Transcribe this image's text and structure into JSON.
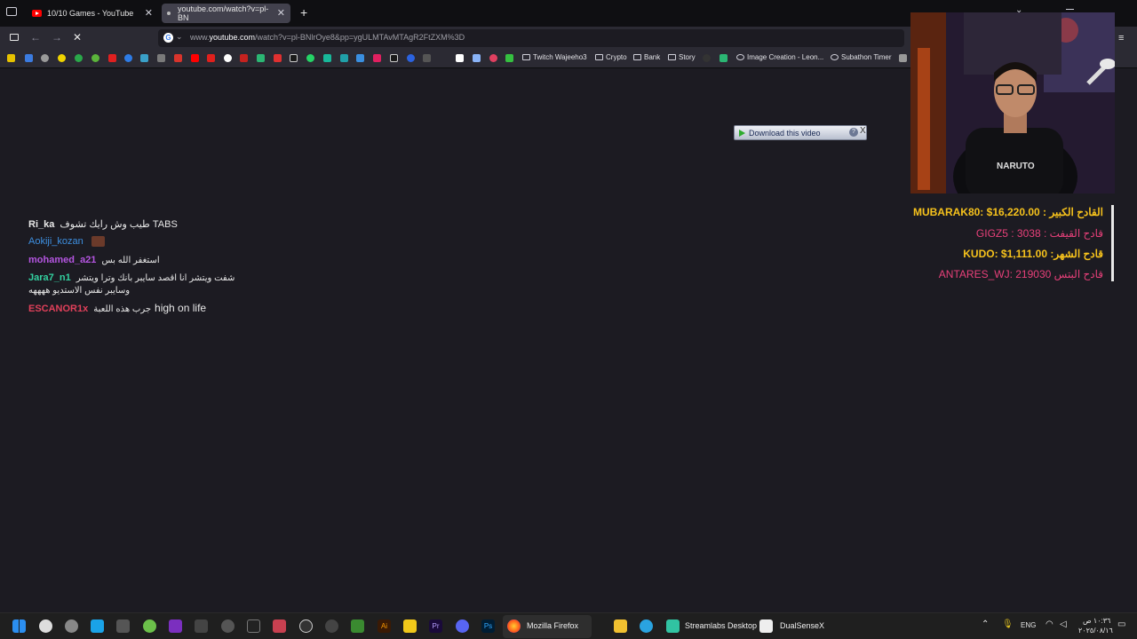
{
  "tabs": [
    {
      "label": "10/10 Games - YouTube",
      "active": false
    },
    {
      "label": "youtube.com/watch?v=pl-BN",
      "active": true
    }
  ],
  "new_tab_glyph": "+",
  "address_bar": {
    "prefix": "www.",
    "domain": "youtube.com",
    "path": "/watch?v=pl-BNlrOye8&pp=ygULMTAvMTAgR2FtZXM%3D"
  },
  "bookmarks": {
    "folders": [
      "Twitch Wajeeho3",
      "Crypto",
      "Bank",
      "Story"
    ],
    "links": [
      "Image Creation - Leon...",
      "Subathon Timer"
    ]
  },
  "download_popup": {
    "label": "Download this video",
    "help": "?",
    "close": "X"
  },
  "chat": [
    {
      "user": "Ri_ka",
      "message": "طيب وش رايك تشوف TABS",
      "color": "#e8e8e8"
    },
    {
      "user": "Aokiji_kozan",
      "message": "",
      "color": "#3d8fe0"
    },
    {
      "user": "mohamed_a21",
      "message": "استغفر الله بس",
      "color": "#b455e0"
    },
    {
      "user": "Jara7_n1",
      "message": "شفت ويتشر انا اقصد سايبر بانك وترا ويتشر",
      "message2": "وسايبر نفس الاستديو ههههه",
      "color": "#33d1a0"
    },
    {
      "user": "ESCANOR1x",
      "message": "جرب هذه اللعبة",
      "message_latin": "high on life",
      "color": "#e0405a"
    }
  ],
  "leaderboard": [
    {
      "text": "MUBARAK80: $16,220.00 : القادح الكبير",
      "color": "#f6c21c"
    },
    {
      "text": "GIGZ5 : 3038 : قادح القيفت",
      "color": "#e8407a"
    },
    {
      "text": "KUDO: $1,111.00 :قادح الشهر",
      "color": "#f6c21c"
    },
    {
      "text": "ANTARES_WJ: 219030 قادح البتس",
      "color": "#e8407a"
    }
  ],
  "webcam": {
    "shirt_text": "NARUTO"
  },
  "taskbar": {
    "apps": [
      "Mozilla Firefox",
      "Streamlabs Desktop",
      "DualSenseX"
    ],
    "tray_language": "ENG",
    "clock_time": "١٠:٣٦ ص",
    "clock_date": "٢٠٢٥/٠٨/١٦"
  }
}
